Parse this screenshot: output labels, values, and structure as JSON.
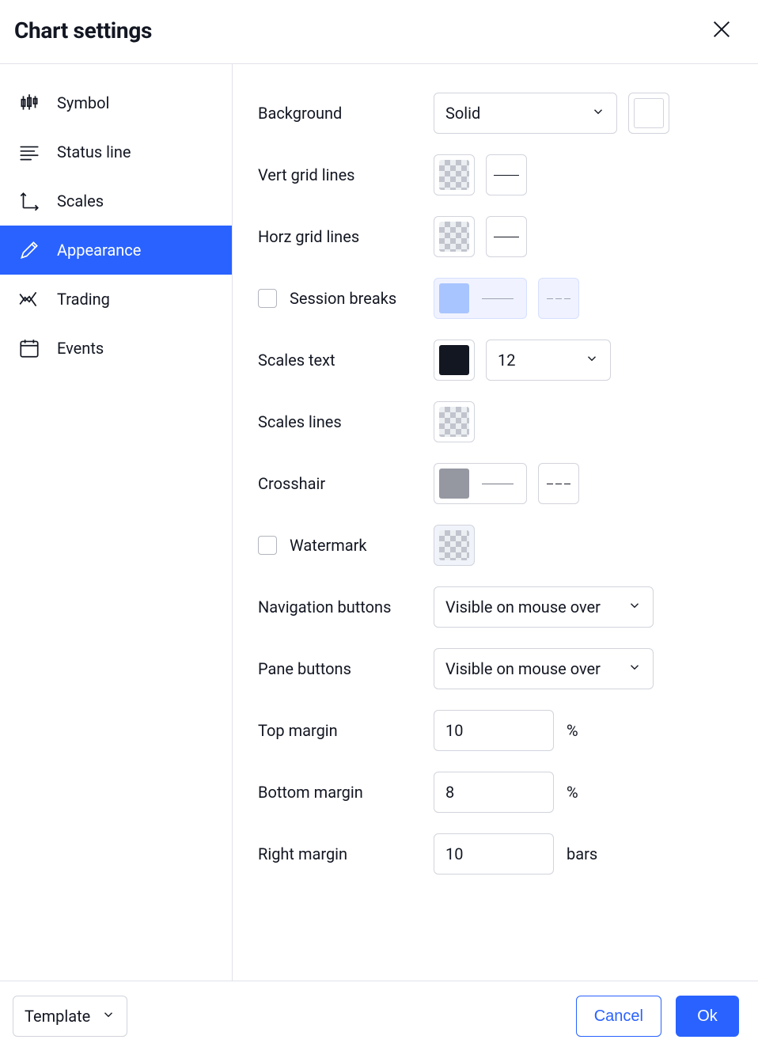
{
  "title": "Chart settings",
  "sidebar": {
    "items": [
      {
        "label": "Symbol"
      },
      {
        "label": "Status line"
      },
      {
        "label": "Scales"
      },
      {
        "label": "Appearance"
      },
      {
        "label": "Trading"
      },
      {
        "label": "Events"
      }
    ]
  },
  "settings": {
    "background": {
      "label": "Background",
      "type": "Solid",
      "color": "#ffffff"
    },
    "vert_grid": {
      "label": "Vert grid lines"
    },
    "horz_grid": {
      "label": "Horz grid lines"
    },
    "session_breaks": {
      "label": "Session breaks",
      "checked": false,
      "color": "#a9c5ff"
    },
    "scales_text": {
      "label": "Scales text",
      "color": "#131722",
      "size": "12"
    },
    "scales_lines": {
      "label": "Scales lines"
    },
    "crosshair": {
      "label": "Crosshair",
      "color": "#9598a1"
    },
    "watermark": {
      "label": "Watermark",
      "checked": false
    },
    "nav_buttons": {
      "label": "Navigation buttons",
      "value": "Visible on mouse over"
    },
    "pane_buttons": {
      "label": "Pane buttons",
      "value": "Visible on mouse over"
    },
    "top_margin": {
      "label": "Top margin",
      "value": "10",
      "unit": "%"
    },
    "bottom_margin": {
      "label": "Bottom margin",
      "value": "8",
      "unit": "%"
    },
    "right_margin": {
      "label": "Right margin",
      "value": "10",
      "unit": "bars"
    }
  },
  "footer": {
    "template": "Template",
    "cancel": "Cancel",
    "ok": "Ok"
  }
}
